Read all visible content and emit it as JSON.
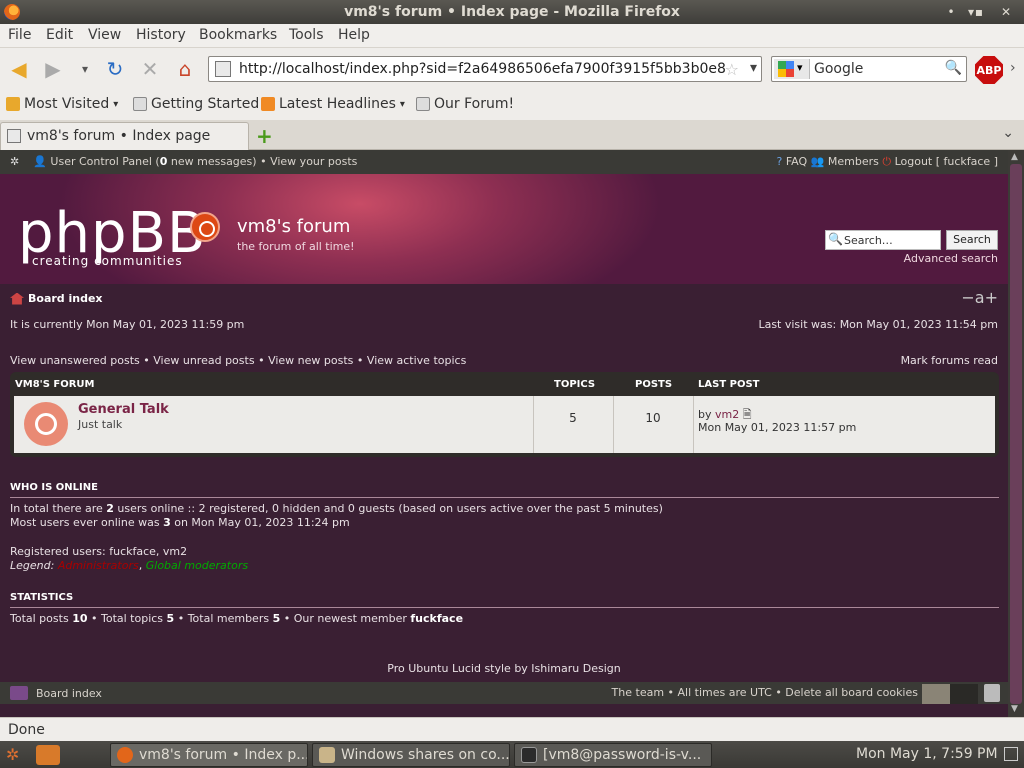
{
  "window": {
    "title": "vm8's forum • Index page - Mozilla Firefox"
  },
  "menu": [
    "File",
    "Edit",
    "View",
    "History",
    "Bookmarks",
    "Tools",
    "Help"
  ],
  "toolbar": {
    "url": "http://localhost/index.php?sid=f2a64986506efa7900f3915f5bb3b0e8",
    "search_engine": "Google",
    "addon": "ABP"
  },
  "bookmarks": [
    "Most Visited",
    "Getting Started",
    "Latest Headlines",
    "Our Forum!"
  ],
  "tab": {
    "label": "vm8's forum • Index page"
  },
  "forum": {
    "topbar": {
      "ucp": "User Control Panel",
      "messages_count": "0",
      "messages_suffix": "new messages)",
      "view_posts": "• View your posts",
      "faq": "FAQ",
      "members": "Members",
      "logout": "Logout [ fuckface ]"
    },
    "header": {
      "logo": "phpBB",
      "logo_sub": "creating   communities",
      "site_title": "vm8's forum",
      "site_desc": "the forum of all time!",
      "search_placeholder": "Search…",
      "search_button": "Search",
      "advanced_search": "Advanced search"
    },
    "breadcrumb": "Board index",
    "font_size_control": "−a+",
    "current_time": "It is currently Mon May 01, 2023 11:59 pm",
    "last_visit": "Last visit was: Mon May 01, 2023 11:54 pm",
    "links": {
      "unanswered": "View unanswered posts",
      "unread": "View unread posts",
      "new": "View new posts",
      "active": "View active topics",
      "mark_read": "Mark forums read",
      "sep": "•"
    },
    "table": {
      "category": "VM8'S FORUM",
      "col_topics": "TOPICS",
      "col_posts": "POSTS",
      "col_last": "LAST POST",
      "row": {
        "name": "General Talk",
        "desc": "Just talk",
        "topics": "5",
        "posts": "10",
        "last_by_prefix": "by",
        "last_by": "vm2",
        "last_time": "Mon May 01, 2023 11:57 pm"
      }
    },
    "online": {
      "heading": "WHO IS ONLINE",
      "line1_a": "In total there are",
      "line1_n": "2",
      "line1_b": "users online :: 2 registered, 0 hidden and 0 guests (based on users active over the past 5 minutes)",
      "line2_a": "Most users ever online was",
      "line2_n": "3",
      "line2_b": "on Mon May 01, 2023 11:24 pm",
      "registered": "Registered users: fuckface, vm2",
      "legend_label": "Legend:",
      "legend_admin": "Administrators",
      "legend_glob": "Global moderators"
    },
    "stats": {
      "heading": "STATISTICS",
      "posts_label": "Total posts",
      "posts": "10",
      "topics_label": "• Total topics",
      "topics": "5",
      "members_label": "• Total members",
      "members": "5",
      "newest_label": "• Our newest member",
      "newest": "fuckface"
    },
    "credit": "Pro Ubuntu Lucid style by Ishimaru Design",
    "footer": {
      "board_index": "Board index",
      "right": "The team • All times are UTC • Delete all board cookies"
    }
  },
  "status": "Done",
  "taskbar": {
    "tasks": [
      "vm8's forum • Index p...",
      "Windows shares on co...",
      "[vm8@password-is-v..."
    ],
    "clock": "Mon May  1,  7:59 PM"
  },
  "colors": {
    "accent": "#7a2446",
    "header": "#8e2f52",
    "ubuntu_orange": "#dd4814"
  }
}
